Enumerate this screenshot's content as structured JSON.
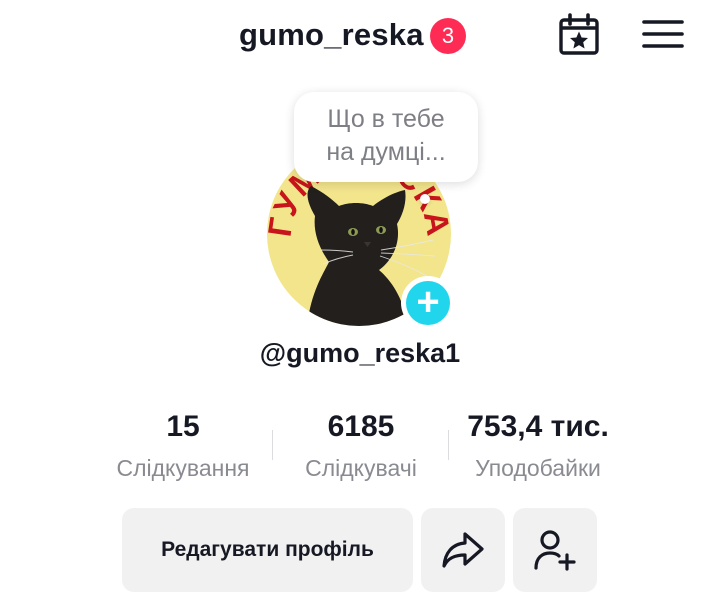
{
  "header": {
    "username": "gumo_reska",
    "notification_count": "3"
  },
  "thought_bubble": {
    "line1": "Що в тебе",
    "line2": "на думці..."
  },
  "avatar": {
    "logo_text": "ГУМОРЕСКА"
  },
  "profile": {
    "handle": "@gumo_reska1"
  },
  "stats": [
    {
      "value": "15",
      "label": "Слідкування"
    },
    {
      "value": "6185",
      "label": "Слідкувачі"
    },
    {
      "value": "753,4 тис.",
      "label": "Уподобайки"
    }
  ],
  "actions": {
    "edit_profile": "Редагувати профіль"
  },
  "colors": {
    "badge": "#fe2c55",
    "add_button": "#20d5ec",
    "button_bg": "#f1f1f2",
    "text": "#161823",
    "secondary_text": "#8a8b91"
  }
}
